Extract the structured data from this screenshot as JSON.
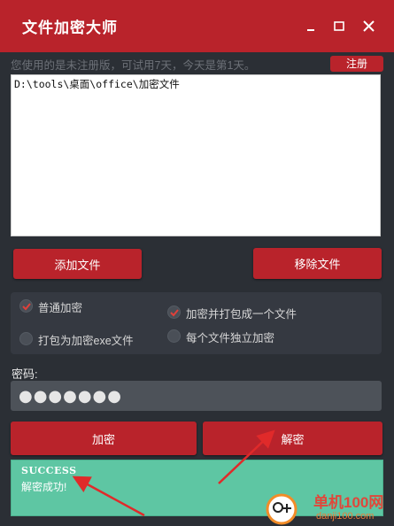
{
  "window": {
    "title": "文件加密大师",
    "controls": [
      "minimize-icon",
      "maximize-icon",
      "close-icon"
    ]
  },
  "trial": {
    "message": "您使用的是未注册版，可试用7天，今天是第1天。",
    "register_label": "注册"
  },
  "file_list": {
    "items": [
      "D:\\tools\\桌面\\office\\加密文件"
    ]
  },
  "file_buttons": {
    "add_label": "添加文件",
    "remove_label": "移除文件"
  },
  "options": {
    "normal_encrypt": {
      "label": "普通加密",
      "checked": true
    },
    "pack_one_file": {
      "label": "加密并打包成一个文件",
      "checked": true
    },
    "pack_exe": {
      "label": "打包为加密exe文件",
      "checked": false
    },
    "each_file": {
      "label": "每个文件独立加密",
      "checked": false
    }
  },
  "password": {
    "label": "密码:",
    "value": "●●●●●●●"
  },
  "actions": {
    "encrypt_label": "加密",
    "decrypt_label": "解密"
  },
  "status": {
    "title": "SUCCESS",
    "message": "解密成功!"
  },
  "watermark": {
    "line1": "单机100网",
    "line2": "danji100.com"
  },
  "colors": {
    "accent": "#b9232b",
    "background": "#2b2f35",
    "success": "#5ec6a3",
    "annotation_arrow": "#e02a2a"
  }
}
